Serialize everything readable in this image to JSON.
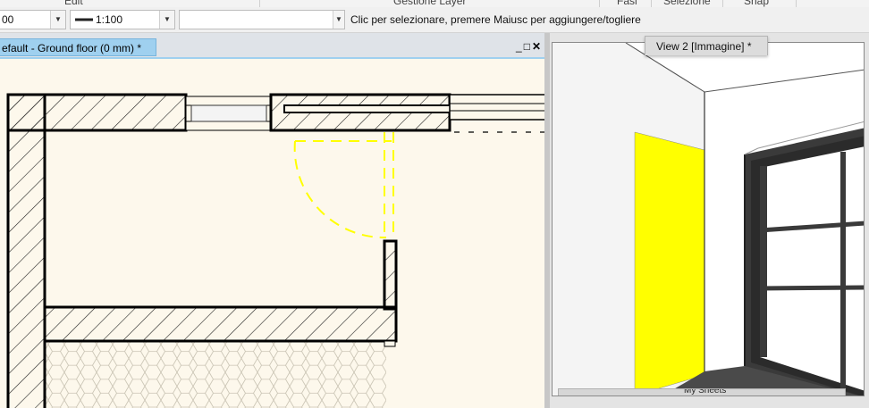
{
  "ribbon": {
    "sections": [
      "Edit",
      "Gestione Layer",
      "Fasi",
      "Selezione",
      "Snap"
    ]
  },
  "toolbar": {
    "combo1_value": "00",
    "linetype_value": "1:100",
    "filter_value": "",
    "status_text": "Clic per selezionare, premere Maiusc per aggiungere/togliere"
  },
  "left_window": {
    "tab_title": "efault - Ground floor (0 mm) *",
    "controls": {
      "minimize": "_",
      "maximize": "□",
      "close": "✕"
    }
  },
  "right_window": {
    "tab_title": "View 2 [Immagine] *",
    "bottom_tab_label": "My Sheets"
  },
  "colors": {
    "plan_background": "#fdf8ec",
    "active_tab": "#9fd0ef",
    "door_swing": "#ffff00",
    "yellow_wall": "#ffff00",
    "door_frame": "#3a3a3a",
    "floor": "#4a4a4a"
  }
}
